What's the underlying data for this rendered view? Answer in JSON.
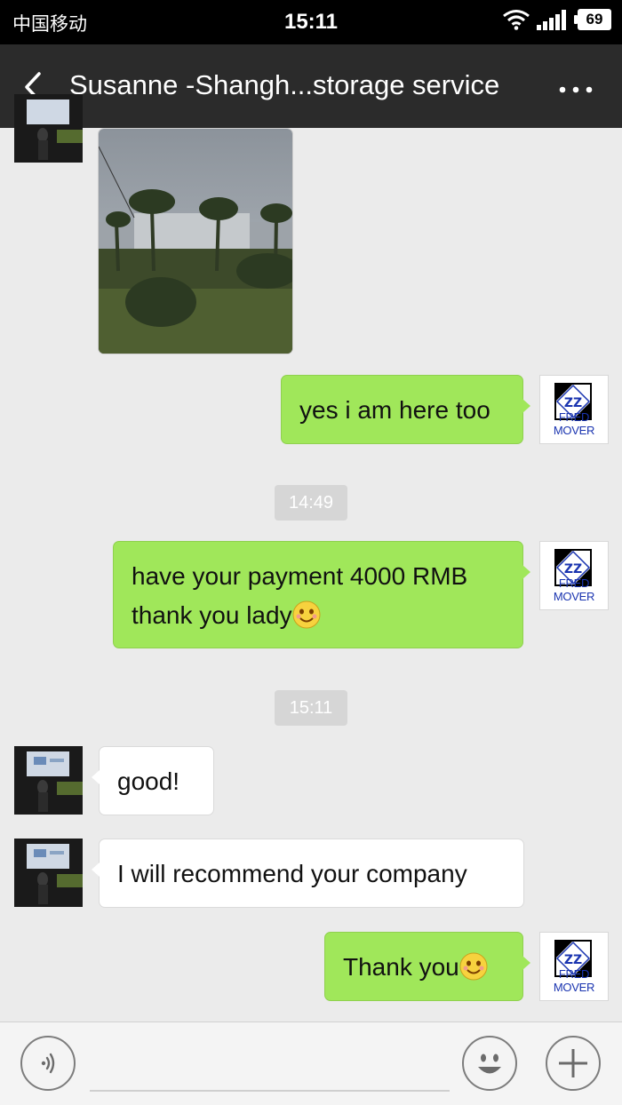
{
  "status_bar": {
    "carrier": "中国移动",
    "time": "15:11",
    "battery": "69",
    "icons": [
      "wifi-icon",
      "signal-icon",
      "battery-icon"
    ]
  },
  "header": {
    "title": "Susanne -Shangh...storage service",
    "back_icon": "chevron-left-icon",
    "more_icon": "more-dots-icon"
  },
  "chat": {
    "messages": [
      {
        "from": "contact",
        "type": "image",
        "content": "photo-of-palm-trees"
      },
      {
        "from": "me",
        "type": "text",
        "text": "yes i am here too"
      },
      {
        "from": "system",
        "type": "timestamp",
        "text": "14:49"
      },
      {
        "from": "me",
        "type": "text",
        "line1": "have your payment 4000 RMB",
        "line2": "thank you lady",
        "emoji": "smile-emoji"
      },
      {
        "from": "system",
        "type": "timestamp",
        "text": "15:11"
      },
      {
        "from": "contact",
        "type": "text",
        "text": "good!"
      },
      {
        "from": "contact",
        "type": "text",
        "text": "I will recommend your company"
      },
      {
        "from": "me",
        "type": "text",
        "text": "Thank you",
        "emoji": "smile-emoji"
      }
    ],
    "my_avatar_label": "FRED MOVER"
  },
  "input_bar": {
    "voice_icon": "voice-icon",
    "emoji_icon": "emoji-face-icon",
    "plus_icon": "plus-icon"
  },
  "colors": {
    "status_bar_bg": "#000000",
    "nav_bg": "#2b2b2b",
    "chat_bg": "#ebebeb",
    "my_bubble": "#a0e75a",
    "their_bubble": "#ffffff",
    "timestamp_bg": "#d6d6d6"
  }
}
